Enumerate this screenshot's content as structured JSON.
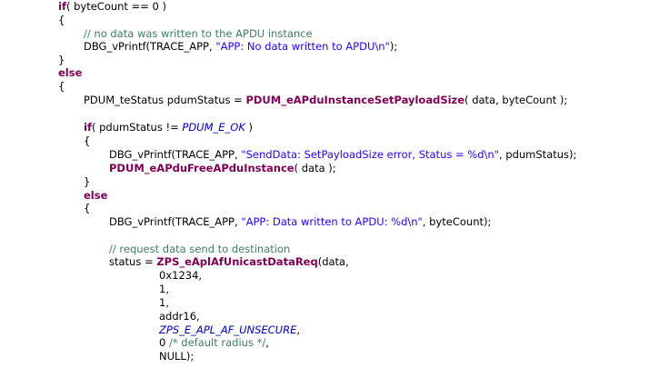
{
  "colors": {
    "keyword": "#7f0055",
    "string": "#2a00ff",
    "comment": "#3f7f5f",
    "enum": "#0000c0",
    "text": "#000000"
  },
  "lines": [
    [
      {
        "t": "if",
        "s": "kw"
      },
      {
        "t": "( byteCount == 0 )",
        "s": ""
      }
    ],
    [
      {
        "t": "{",
        "s": ""
      }
    ],
    [
      {
        "t": "// no data was written to the APDU instance",
        "s": "cm"
      }
    ],
    [
      {
        "t": "DBG_vPrintf(TRACE_APP, ",
        "s": ""
      },
      {
        "t": "\"APP: No data written to APDU\\n\"",
        "s": "str"
      },
      {
        "t": ");",
        "s": ""
      }
    ],
    [
      {
        "t": "}",
        "s": ""
      }
    ],
    [
      {
        "t": "else",
        "s": "kw"
      }
    ],
    [
      {
        "t": "{",
        "s": ""
      }
    ],
    [
      {
        "t": "PDUM_teStatus pdumStatus = ",
        "s": ""
      },
      {
        "t": "PDUM_eAPduInstanceSetPayloadSize",
        "s": "fn"
      },
      {
        "t": "( data, byteCount );",
        "s": ""
      }
    ],
    [
      {
        "t": "if",
        "s": "kw"
      },
      {
        "t": "( pdumStatus != ",
        "s": ""
      },
      {
        "t": "PDUM_E_OK",
        "s": "en"
      },
      {
        "t": " )",
        "s": ""
      }
    ],
    [
      {
        "t": "{",
        "s": ""
      }
    ],
    [
      {
        "t": "DBG_vPrintf(TRACE_APP, ",
        "s": ""
      },
      {
        "t": "\"SendData: SetPayloadSize error, Status = %d\\n\"",
        "s": "str"
      },
      {
        "t": ", pdumStatus);",
        "s": ""
      }
    ],
    [
      {
        "t": "PDUM_eAPduFreeAPduInstance",
        "s": "fn"
      },
      {
        "t": "( data );",
        "s": ""
      }
    ],
    [
      {
        "t": "}",
        "s": ""
      }
    ],
    [
      {
        "t": "else",
        "s": "kw"
      }
    ],
    [
      {
        "t": "{",
        "s": ""
      }
    ],
    [
      {
        "t": "DBG_vPrintf(TRACE_APP, ",
        "s": ""
      },
      {
        "t": "\"APP: Data written to APDU: %d\\n\"",
        "s": "str"
      },
      {
        "t": ", byteCount);",
        "s": ""
      }
    ],
    [
      {
        "t": "// request data send to destination",
        "s": "cm"
      }
    ],
    [
      {
        "t": "status = ",
        "s": ""
      },
      {
        "t": "ZPS_eAplAfUnicastDataReq",
        "s": "fn"
      },
      {
        "t": "(data,",
        "s": ""
      }
    ],
    [
      {
        "t": "0x1234,",
        "s": ""
      }
    ],
    [
      {
        "t": "1,",
        "s": ""
      }
    ],
    [
      {
        "t": "1,",
        "s": ""
      }
    ],
    [
      {
        "t": "addr16,",
        "s": ""
      }
    ],
    [
      {
        "t": "ZPS_E_APL_AF_UNSECURE",
        "s": "en"
      },
      {
        "t": ",",
        "s": ""
      }
    ],
    [
      {
        "t": "0 ",
        "s": ""
      },
      {
        "t": "/* default radius */",
        "s": "cm"
      },
      {
        "t": ",",
        "s": ""
      }
    ],
    [
      {
        "t": "NULL);",
        "s": ""
      }
    ]
  ]
}
